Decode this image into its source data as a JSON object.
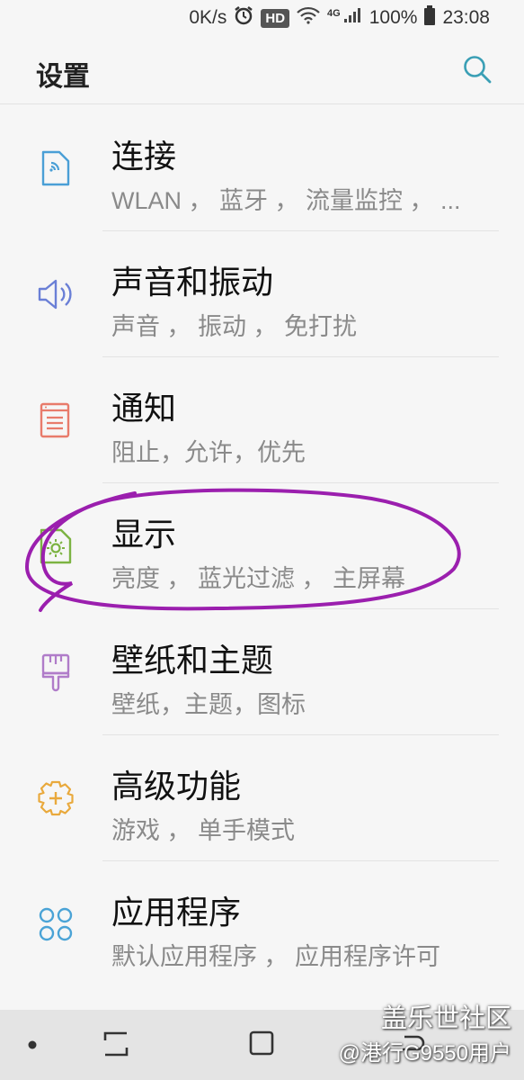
{
  "status_bar": {
    "speed": "0K/s",
    "hd": "HD",
    "network": "4G",
    "battery": "100%",
    "time": "23:08",
    "icons": [
      "alarm-icon",
      "wifi-icon",
      "signal-icon",
      "battery-icon"
    ]
  },
  "header": {
    "title": "设置",
    "search_icon": "search-icon"
  },
  "items": [
    {
      "label": "连接",
      "sub": "WLAN ， 蓝牙 ， 流量监控 ， ...",
      "icon": "connection-icon",
      "color": "#4a9fd6"
    },
    {
      "label": "声音和振动",
      "sub": "声音 ， 振动 ， 免打扰",
      "icon": "sound-icon",
      "color": "#6a7fd6"
    },
    {
      "label": "通知",
      "sub": "阻止，允许，优先",
      "icon": "notification-icon",
      "color": "#e87b6b"
    },
    {
      "label": "显示",
      "sub": "亮度 ， 蓝光过滤 ， 主屏幕",
      "icon": "display-icon",
      "color": "#7cb342"
    },
    {
      "label": "壁纸和主题",
      "sub": "壁纸，主题，图标",
      "icon": "theme-icon",
      "color": "#b07cc9"
    },
    {
      "label": "高级功能",
      "sub": "游戏 ， 单手模式",
      "icon": "advanced-icon",
      "color": "#e9a93c"
    },
    {
      "label": "应用程序",
      "sub": "默认应用程序 ， 应用程序许可",
      "icon": "apps-icon",
      "color": "#4aa3d6"
    }
  ],
  "nav_bar": {
    "icons": [
      "dot-icon",
      "recents-icon",
      "home-icon",
      "back-icon"
    ]
  },
  "watermark": {
    "line1": "盖乐世社区",
    "line2": "@港行G9550用户"
  },
  "colors": {
    "background": "#f6f6f6",
    "annotation": "#9b1fae",
    "search": "#3a9fb5"
  }
}
